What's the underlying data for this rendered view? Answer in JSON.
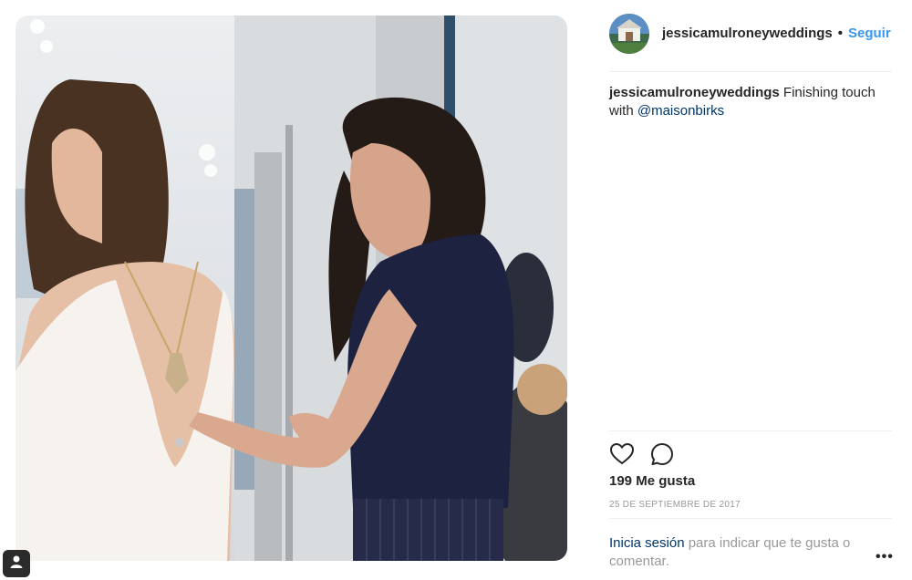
{
  "post": {
    "username": "jessicamulroneyweddings",
    "separator": "•",
    "follow_label": "Seguir",
    "caption_user": "jessicamulroneyweddings",
    "caption_text": " Finishing touch with ",
    "caption_mention": "@maisonbirks",
    "likes_text": "199 Me gusta",
    "date_text": "25 DE SEPTIEMBRE DE 2017",
    "login_link": "Inicia sesión",
    "login_text": " para indicar que te gusta o comentar.",
    "more_label": "•••"
  },
  "icons": {
    "like": "heart-icon",
    "comment": "comment-icon",
    "tagged_user": "user-icon"
  },
  "colors": {
    "follow_blue": "#3897f0",
    "mention_blue": "#003569",
    "muted_gray": "#999999"
  }
}
